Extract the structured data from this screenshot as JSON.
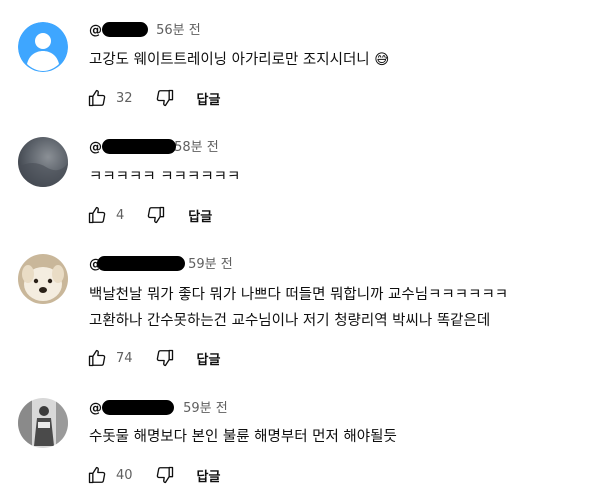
{
  "comments": [
    {
      "handle": "@",
      "time": "56분 전",
      "text": "고강도 웨이트트레이닝 아가리로만 조지시더니",
      "emoji": "😅",
      "likes": "32",
      "reply_label": "답글"
    },
    {
      "handle": "@",
      "time": "58분 전",
      "text": "ㅋㅋㅋㅋㅋ ㅋㅋㅋㅋㅋㅋ",
      "likes": "4",
      "reply_label": "답글"
    },
    {
      "handle": "@",
      "time": "59분 전",
      "text_line1": "백날천날 뭐가 좋다 뭐가 나쁘다 떠들면 뭐합니까 교수님ㅋㅋㅋㅋㅋㅋ",
      "text_line2": "고환하나 간수못하는건 교수님이나 저기 청량리역 박씨나 똑같은데",
      "likes": "74",
      "reply_label": "답글"
    },
    {
      "handle": "@",
      "time": "59분 전",
      "text": "수돗물 해명보다 본인 불륜 해명부터 먼저 해야될듯",
      "likes": "40",
      "reply_label": "답글"
    }
  ],
  "icons": {
    "like": "thumbs-up-icon",
    "dislike": "thumbs-down-icon"
  },
  "colors": {
    "text": "#0f0f0f",
    "secondary": "#606060",
    "default_avatar": "#3ea6ff"
  }
}
